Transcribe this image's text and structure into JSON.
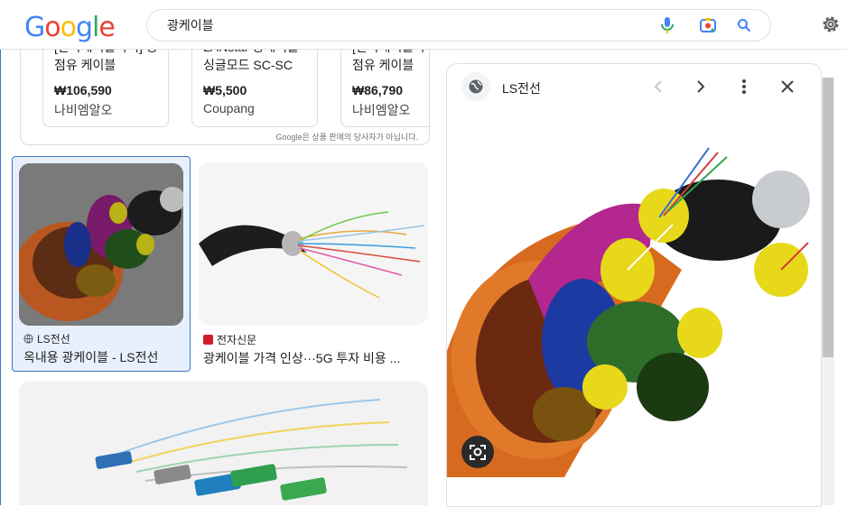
{
  "logo": {
    "g1": "G",
    "o1": "o",
    "o2": "o",
    "g2": "g",
    "l": "l",
    "e": "e"
  },
  "search": {
    "value": "광케이블",
    "voice_icon": "mic-icon",
    "lens_icon": "camera-icon",
    "search_icon": "search-icon"
  },
  "settings_icon": "gear-icon",
  "shopping": {
    "products": [
      {
        "title": "[한국케이블라이] 광점유 케이블",
        "price": "₩106,590",
        "store": "나비엠알오"
      },
      {
        "title": "LANstar 광케이블 싱글모드 SC-SC",
        "price": "₩5,500",
        "store": "Coupang"
      },
      {
        "title": "[한국케이블라이] 광점유 케이블",
        "price": "₩86,790",
        "store": "나비엠알오"
      }
    ],
    "disclaimer": "Google은 상품 판매의 당사자가 아닙니다."
  },
  "results": [
    {
      "source": "LS전선",
      "title": "옥내용 광케이블 - LS전선"
    },
    {
      "source": "전자신문",
      "title": "광케이블 가격 인상···5G 투자 비용 ..."
    }
  ],
  "panel": {
    "source": "LS전선"
  },
  "colors": {
    "blue": "#4285f4",
    "red": "#ea4335",
    "yellow": "#fbbc05",
    "green": "#34a853",
    "selection": "#3a78c2"
  }
}
